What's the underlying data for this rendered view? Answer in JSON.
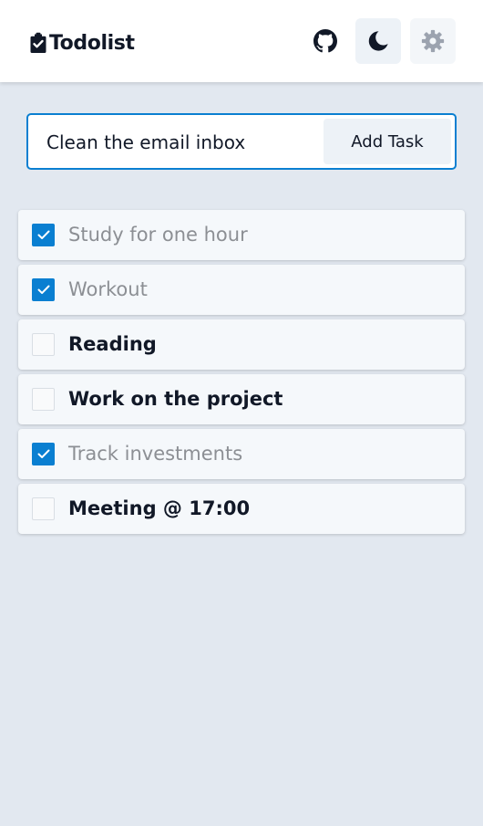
{
  "app": {
    "title": "Todolist",
    "logo_icon": "clipboard-check-icon",
    "accent_color": "#0a7fd1",
    "background_color": "#e2e8f0"
  },
  "header": {
    "buttons": [
      {
        "name": "github-button",
        "icon": "github-icon"
      },
      {
        "name": "theme-toggle-button",
        "icon": "moon-icon"
      },
      {
        "name": "settings-button",
        "icon": "gear-icon"
      }
    ]
  },
  "add_task": {
    "input_value": "Clean the email inbox",
    "button_label": "Add Task"
  },
  "tasks": [
    {
      "label": "Study for one hour",
      "completed": true
    },
    {
      "label": "Workout",
      "completed": true
    },
    {
      "label": "Reading",
      "completed": false
    },
    {
      "label": "Work on the project",
      "completed": false
    },
    {
      "label": "Track investments",
      "completed": true
    },
    {
      "label": "Meeting @ 17:00",
      "completed": false
    }
  ]
}
